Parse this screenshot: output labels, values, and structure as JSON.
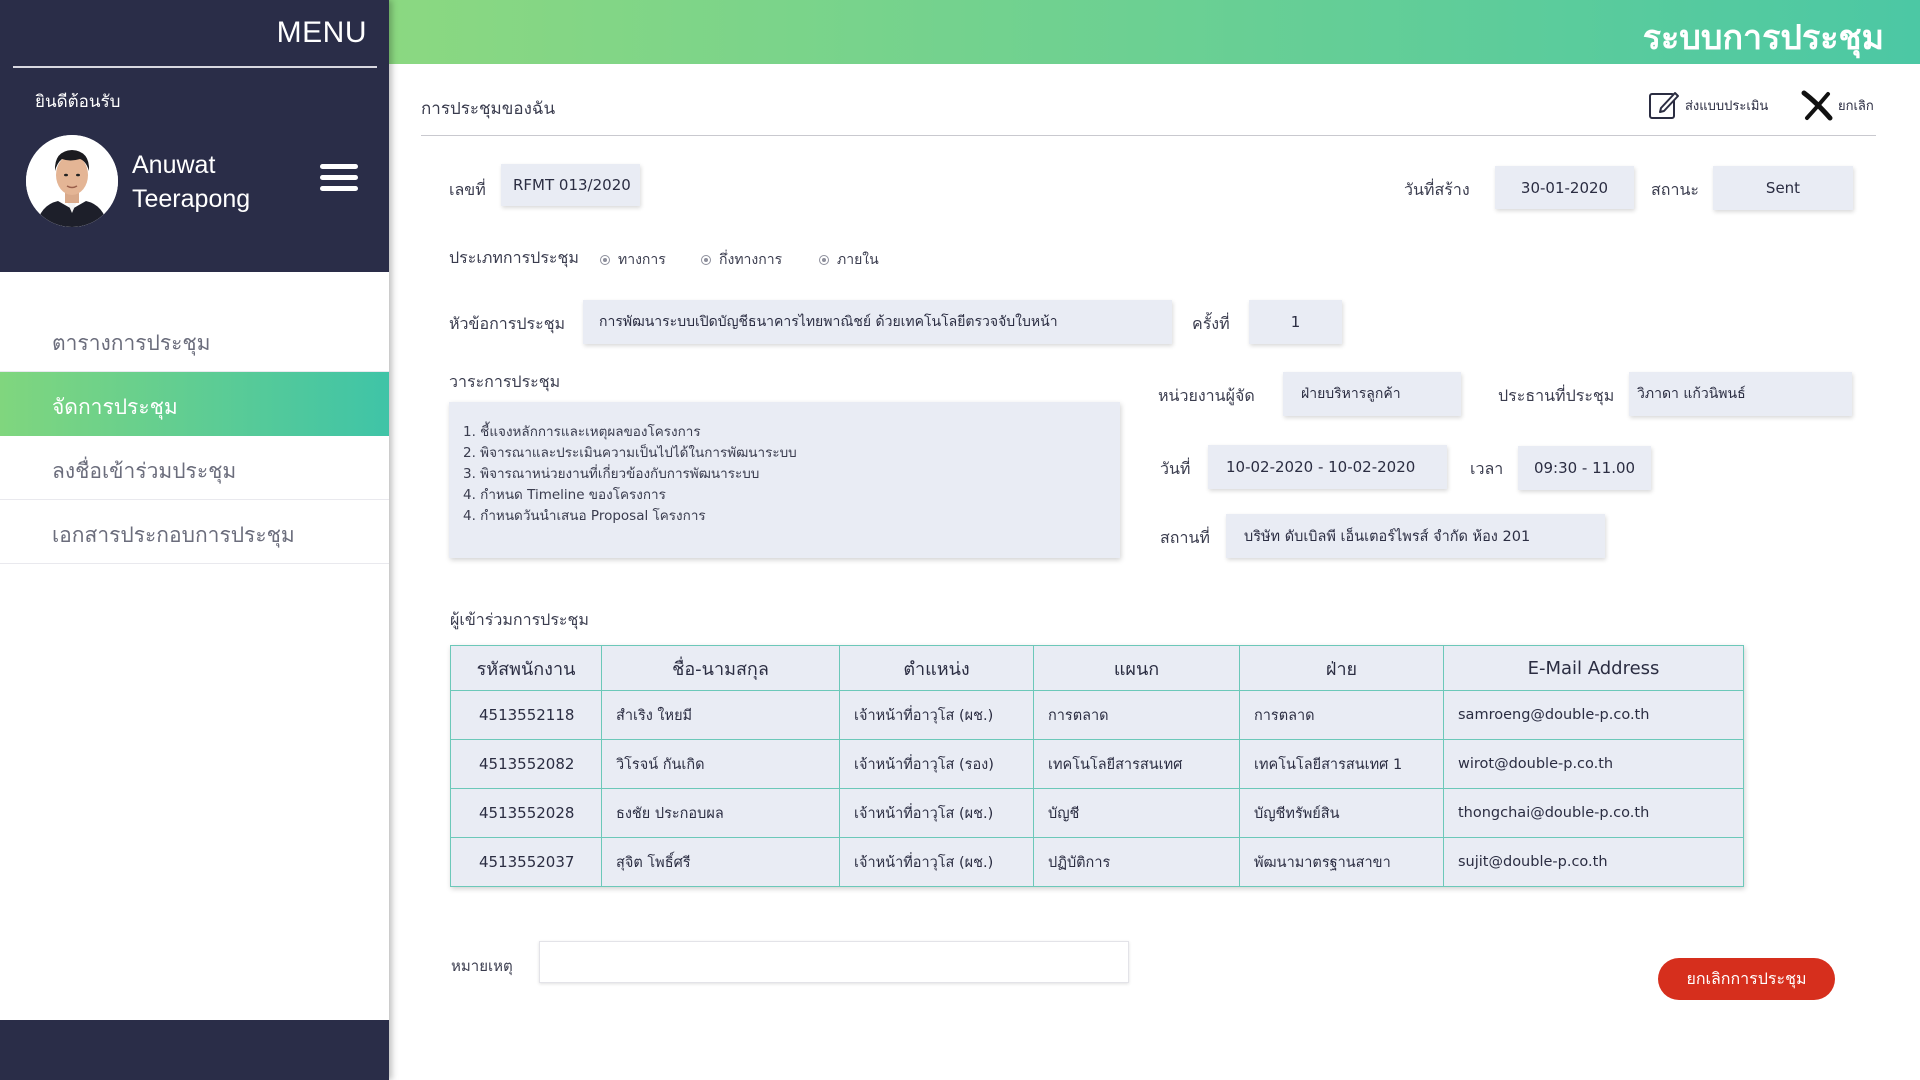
{
  "sidebar": {
    "menu_title": "MENU",
    "welcome": "ยินดีต้อนรับ",
    "user_first": "Anuwat",
    "user_last": "Teerapong",
    "items": [
      {
        "label": "ตารางการประชุม",
        "active": false
      },
      {
        "label": "จัดการประชุม",
        "active": true
      },
      {
        "label": "ลงชื่อเข้าร่วมประชุม",
        "active": false
      },
      {
        "label": "เอกสารประกอบการประชุม",
        "active": false
      }
    ]
  },
  "header": {
    "title": "ระบบการประชุม"
  },
  "page": {
    "title": "การประชุมของฉัน",
    "actions": {
      "evaluate": "ส่งแบบประเมิน",
      "cancel": "ยกเลิก"
    }
  },
  "form": {
    "number_label": "เลขที่",
    "number_value": "RFMT 013/2020",
    "created_label": "วันที่สร้าง",
    "created_value": "30-01-2020",
    "status_label": "สถานะ",
    "status_value": "Sent",
    "type_label": "ประเภทการประชุม",
    "type_options": [
      "ทางการ",
      "กึ่งทางการ",
      "ภายใน"
    ],
    "topic_label": "หัวข้อการประชุม",
    "topic_value": "การพัฒนาระบบเปิดบัญชีธนาคารไทยพาณิชย์ ด้วยเทคโนโลยีตรวจจับใบหน้า",
    "round_label": "ครั้งที่",
    "round_value": "1",
    "agenda_label": "วาระการประชุม",
    "agenda": [
      "1. ชี้แจงหลักการและเหตุผลของโครงการ",
      "2. พิจารณาและประเมินความเป็นไปได้ในการพัฒนาระบบ",
      "3. พิจารณาหน่วยงานที่เกี่ยวข้องกับการพัฒนาระบบ",
      "4. กำหนด Timeline ของโครงการ",
      "4. กำหนดวันนำเสนอ Proposal โครงการ"
    ],
    "org_label": "หน่วยงานผู้จัด",
    "org_value": "ฝ่ายบริหารลูกค้า",
    "chair_label": "ประธานที่ประชุม",
    "chair_value": "วิภาดา แก้วนิพนธ์",
    "date_label": "วันที่",
    "date_value": "10-02-2020 - 10-02-2020",
    "time_label": "เวลา",
    "time_value": "09:30 - 11.00",
    "place_label": "สถานที่",
    "place_value": "บริษัท ดับเบิลพี เอ็นเตอร์ไพรส์ จำกัด ห้อง 201"
  },
  "attendees": {
    "title": "ผู้เข้าร่วมการประชุม",
    "columns": [
      "รหัสพนักงาน",
      "ชื่อ-นามสกุล",
      "ตำแหน่ง",
      "แผนก",
      "ฝ่าย",
      "E-Mail Address"
    ],
    "rows": [
      [
        "4513552118",
        "สำเริง ใหยมี",
        "เจ้าหน้าที่อาวุโส (ผช.)",
        "การตลาด",
        "การตลาด",
        "samroeng@double-p.co.th"
      ],
      [
        "4513552082",
        "วิโรจน์ กันเกิด",
        "เจ้าหน้าที่อาวุโส (รอง)",
        "เทคโนโลยีสารสนเทศ",
        "เทคโนโลยีสารสนเทศ 1",
        "wirot@double-p.co.th"
      ],
      [
        "4513552028",
        "ธงชัย ประกอบผล",
        "เจ้าหน้าที่อาวุโส (ผช.)",
        "บัญชี",
        "บัญชีทรัพย์สิน",
        "thongchai@double-p.co.th"
      ],
      [
        "4513552037",
        "สุจิต โพธิ์ศรี",
        "เจ้าหน้าที่อาวุโส (ผช.)",
        "ปฏิบัติการ",
        "พัฒนามาตรฐานสาขา",
        "sujit@double-p.co.th"
      ]
    ]
  },
  "note": {
    "label": "หมายเหตุ",
    "value": ""
  },
  "buttons": {
    "cancel_meeting": "ยกเลิกการประชุม"
  },
  "colors": {
    "sidebar_bg": "#2a2d48",
    "accent_start": "#80d67e",
    "accent_end": "#3fc4a7",
    "danger": "#d62f1d"
  }
}
